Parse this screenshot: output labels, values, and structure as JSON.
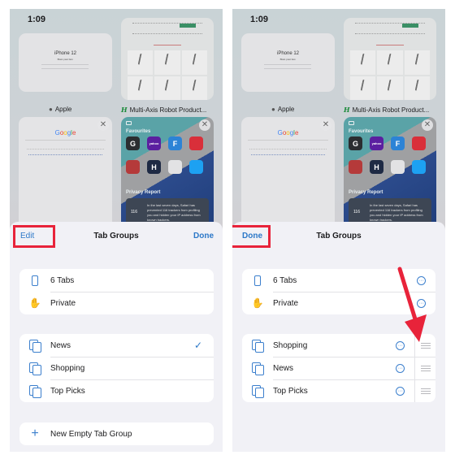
{
  "status_bar": {
    "time": "1:09"
  },
  "tab_previews": [
    {
      "name": "apple",
      "label": "Apple",
      "page_title": "iPhone 12",
      "page_subtitle": "Blast past fast."
    },
    {
      "name": "robot",
      "label": "Multi-Axis Robot Product...",
      "favicon": "H"
    },
    {
      "name": "google",
      "logo_letters": [
        "G",
        "o",
        "o",
        "g",
        "l",
        "e"
      ]
    },
    {
      "name": "start-page",
      "favourites_title": "Favourites",
      "favourites": [
        {
          "label": "G",
          "color": "#2b2d30"
        },
        {
          "label": "yahoo",
          "color": "#5b1fa0"
        },
        {
          "label": "F",
          "color": "#2c83d6"
        },
        {
          "label": "",
          "color": "#d92f3a"
        },
        {
          "label": "",
          "color": "#b53a3a"
        },
        {
          "label": "H",
          "color": "#1e2a44"
        },
        {
          "label": "",
          "color": "#e2e2e4"
        },
        {
          "label": "",
          "color": "#1da1f2"
        }
      ],
      "privacy_title": "Privacy Report",
      "privacy_count": "116",
      "privacy_text": "In the last seven days, Safari has prevented 116 trackers from profiling you and hidden your IP address from known trackers."
    }
  ],
  "left_sheet": {
    "title": "Tab Groups",
    "edit_label": "Edit",
    "done_label": "Done",
    "fixed_groups": [
      {
        "label": "6 Tabs",
        "icon": "iphone-icon"
      },
      {
        "label": "Private",
        "icon": "hand-icon"
      }
    ],
    "tab_groups": [
      {
        "label": "News",
        "selected": true
      },
      {
        "label": "Shopping",
        "selected": false
      },
      {
        "label": "Top Picks",
        "selected": false
      }
    ],
    "new_group_label": "New Empty Tab Group",
    "checkmark": "✓"
  },
  "right_sheet": {
    "title": "Tab Groups",
    "done_label": "Done",
    "fixed_groups": [
      {
        "label": "6 Tabs",
        "icon": "iphone-icon"
      },
      {
        "label": "Private",
        "icon": "hand-icon"
      }
    ],
    "tab_groups": [
      {
        "label": "Shopping"
      },
      {
        "label": "News"
      },
      {
        "label": "Top Picks"
      }
    ]
  },
  "glyphs": {
    "close": "✕",
    "more": "···",
    "plus": "+",
    "hand": "✋",
    "apple": "",
    "wifi": "◉"
  },
  "colors": {
    "accent": "#2c78c8",
    "highlight": "#e8233a",
    "sheet_bg": "#f1f1f6"
  }
}
